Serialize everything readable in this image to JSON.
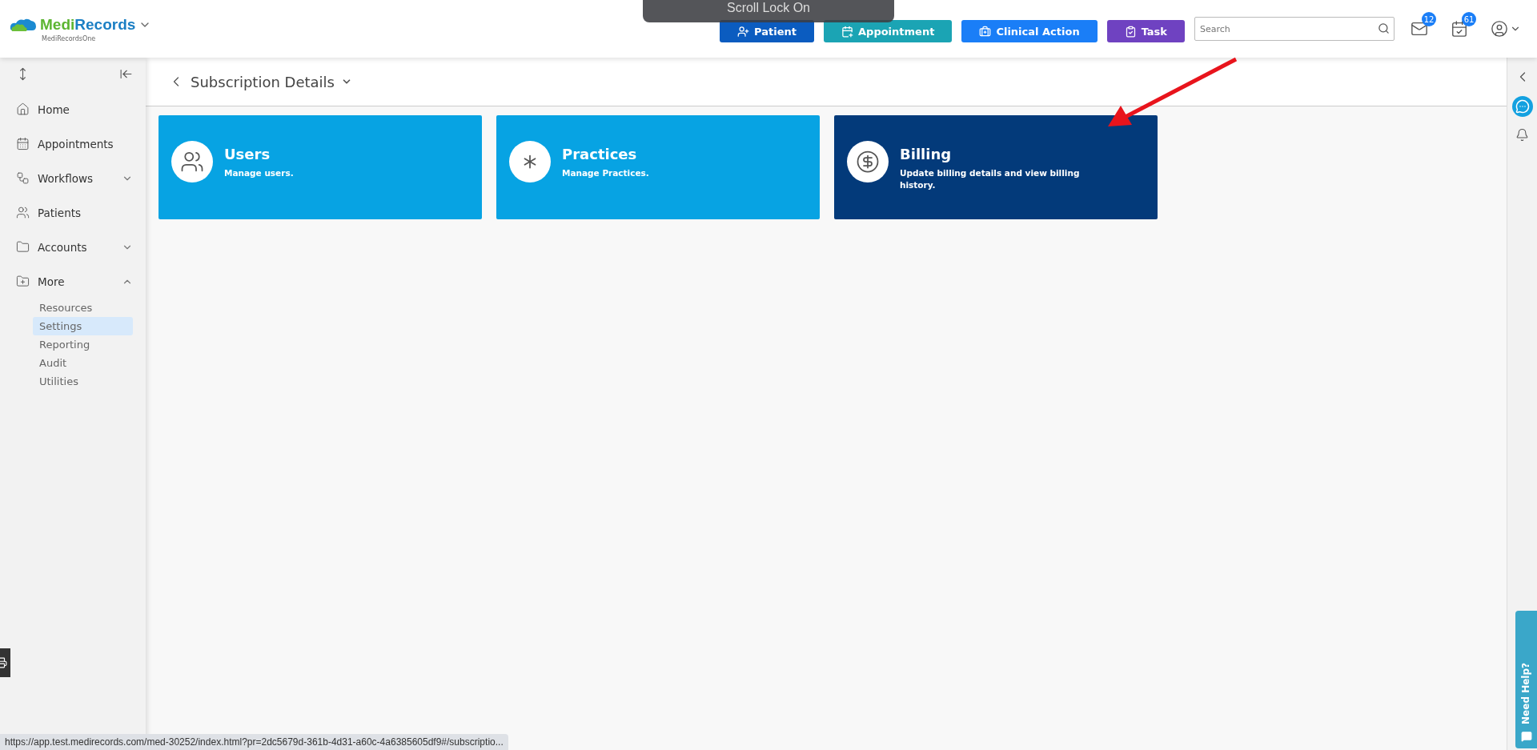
{
  "header": {
    "logo": {
      "name_parts": [
        "Medi",
        "Records"
      ],
      "subtitle": "MediRecordsOne"
    },
    "buttons": [
      {
        "label": "Patient",
        "color": "#0b5cc0"
      },
      {
        "label": "Appointment",
        "color": "#1ba4b4"
      },
      {
        "label": "Clinical Action",
        "color": "#1a7ef7"
      },
      {
        "label": "Task",
        "color": "#6f42c1"
      }
    ],
    "search": {
      "placeholder": "Search"
    },
    "mail_badge": "12",
    "tasks_badge": "61"
  },
  "toast": "Scroll Lock On",
  "sidebar": {
    "items": [
      {
        "label": "Home",
        "kind": "link"
      },
      {
        "label": "Appointments",
        "kind": "link"
      },
      {
        "label": "Workflows",
        "kind": "group",
        "expanded": false
      },
      {
        "label": "Patients",
        "kind": "link"
      },
      {
        "label": "Accounts",
        "kind": "group",
        "expanded": false
      },
      {
        "label": "More",
        "kind": "group",
        "expanded": true,
        "children": [
          {
            "label": "Resources",
            "selected": false
          },
          {
            "label": "Settings",
            "selected": true
          },
          {
            "label": "Reporting",
            "selected": false
          },
          {
            "label": "Audit",
            "selected": false
          },
          {
            "label": "Utilities",
            "selected": false
          }
        ]
      }
    ]
  },
  "page": {
    "title": "Subscription Details",
    "cards": [
      {
        "title": "Users",
        "description": "Manage users.",
        "highlighted": false
      },
      {
        "title": "Practices",
        "description": "Manage Practices.",
        "highlighted": false
      },
      {
        "title": "Billing",
        "description": "Update billing details and view billing history.",
        "highlighted": true
      }
    ]
  },
  "help_tab": "Need Help?",
  "status_url": "https://app.test.medirecords.com/med-30252/index.html?pr=2dc5679d-361b-4d31-a60c-4a6385605df9#/subscriptio..."
}
